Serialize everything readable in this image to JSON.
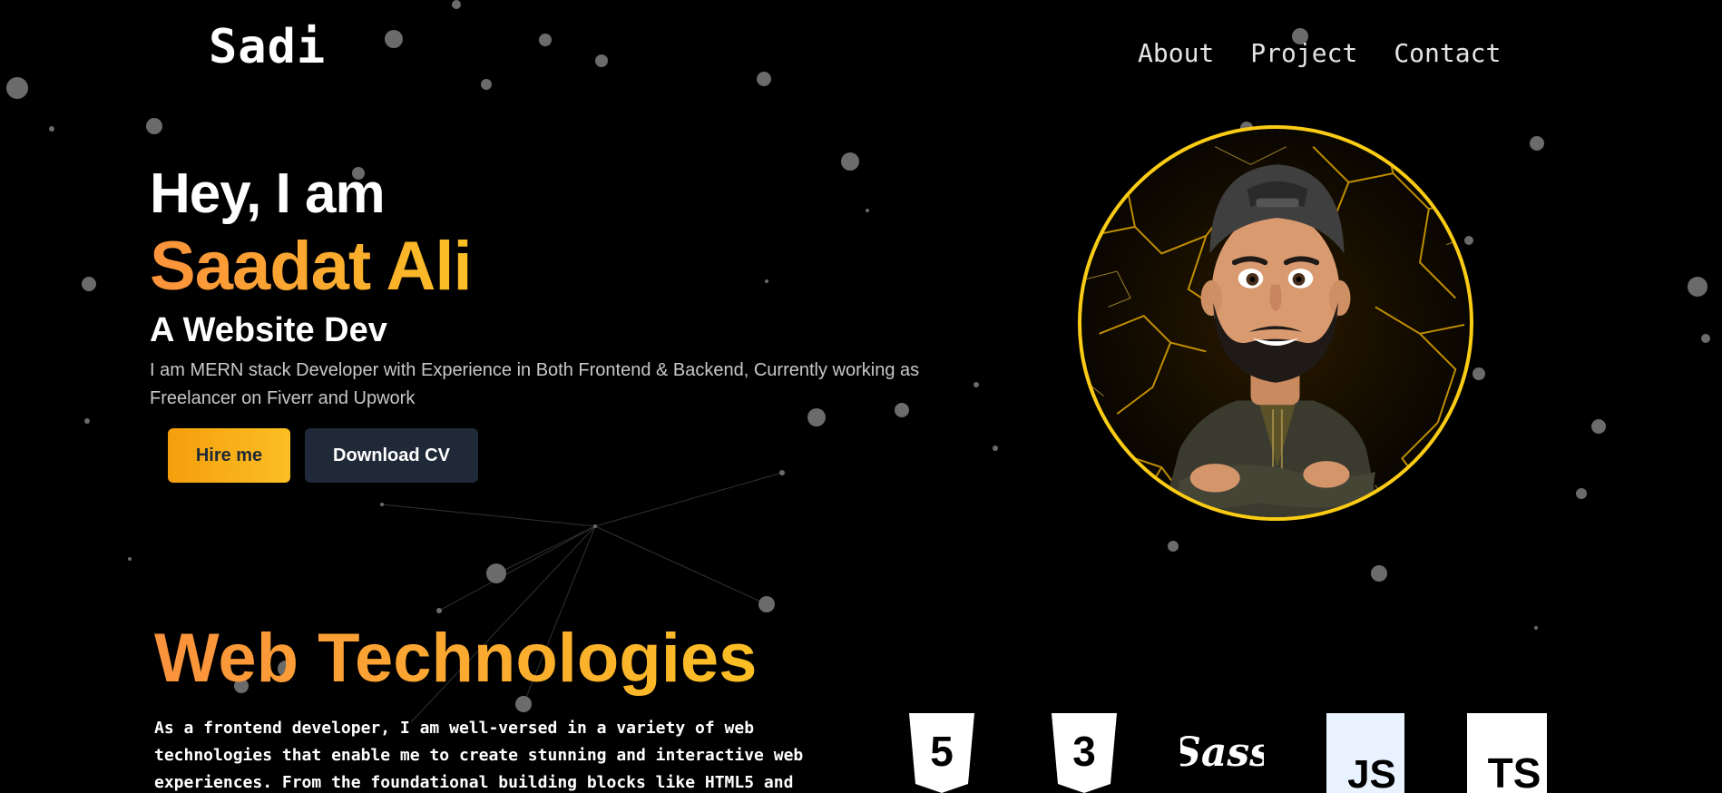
{
  "header": {
    "logo": "Sadi",
    "nav": [
      {
        "label": "About"
      },
      {
        "label": "Project"
      },
      {
        "label": "Contact"
      }
    ]
  },
  "hero": {
    "greeting": "Hey, I am",
    "name": "Saadat Ali",
    "role": "A Website Dev",
    "description": "I am MERN stack Developer with Experience in Both Frontend & Backend, Currently working as Freelancer on Fiverr and Upwork",
    "hire_label": "Hire me",
    "cv_label": "Download CV",
    "avatar_icon": "avatar-memoji-icon"
  },
  "technologies": {
    "title": "Web Technologies",
    "description": "As a frontend developer, I am well-versed in a variety of web technologies that enable me to create stunning and interactive web experiences. From the foundational building blocks like HTML5 and",
    "icons": [
      {
        "name": "html5-icon",
        "glyph": "5"
      },
      {
        "name": "css3-icon",
        "glyph": "3"
      },
      {
        "name": "sass-icon",
        "glyph": "Sass"
      },
      {
        "name": "javascript-icon",
        "glyph": "JS"
      },
      {
        "name": "typescript-icon",
        "glyph": "TS"
      }
    ]
  },
  "colors": {
    "accent_start": "#fb923c",
    "accent_end": "#fbbf24",
    "button_dark": "#1f2937",
    "avatar_ring": "#facc15"
  }
}
